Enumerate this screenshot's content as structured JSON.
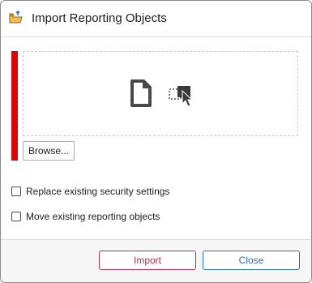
{
  "dialog": {
    "title": "Import Reporting Objects",
    "title_icon": "folder-import-icon"
  },
  "dropzone": {
    "file_icon": "document-icon",
    "drag_icon": "drag-drop-cursor-icon",
    "browse_label": "Browse...",
    "required_color": "#d40a0a"
  },
  "options": [
    {
      "label": "Replace existing security settings",
      "checked": false
    },
    {
      "label": "Move existing reporting objects",
      "checked": false
    }
  ],
  "footer": {
    "import_label": "Import",
    "close_label": "Close",
    "import_color": "#b5304a",
    "close_color": "#2b6ea8"
  }
}
